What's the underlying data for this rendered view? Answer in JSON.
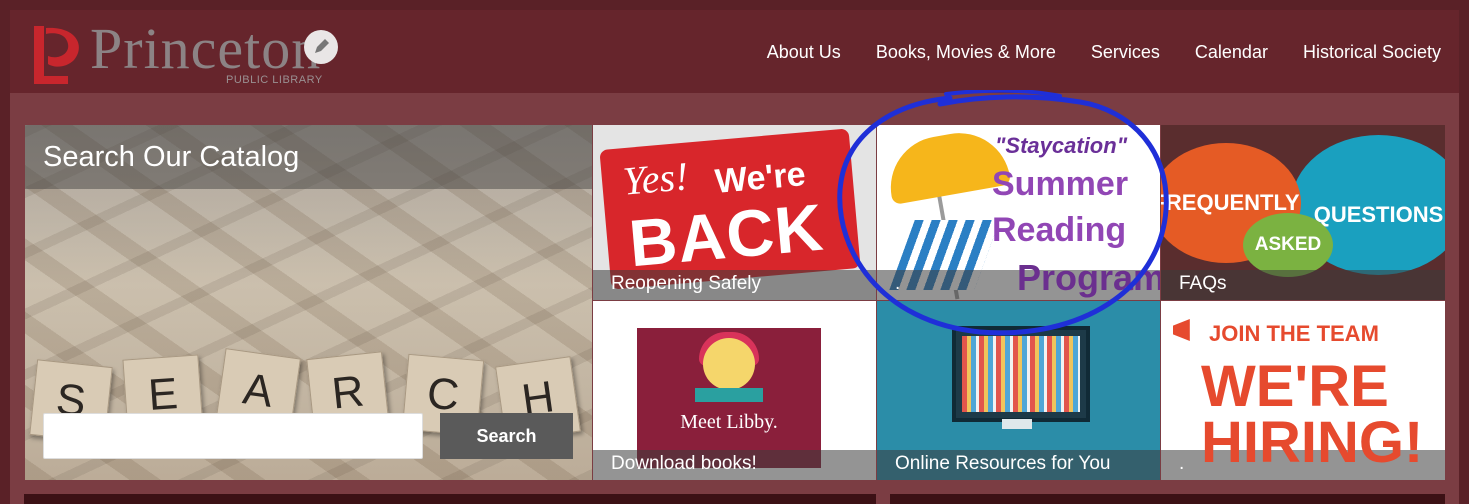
{
  "logo": {
    "name": "Princeton",
    "subtitle": "PUBLIC LIBRARY"
  },
  "nav": {
    "items": [
      "About Us",
      "Books, Movies & More",
      "Services",
      "Calendar",
      "Historical Society"
    ]
  },
  "search": {
    "title": "Search Our Catalog",
    "input_value": "",
    "button_label": "Search",
    "letters": [
      "S",
      "E",
      "A",
      "R",
      "C",
      "H"
    ]
  },
  "tiles": {
    "reopen": {
      "caption": "Reopening Safely",
      "yes": "Yes!",
      "were": "We're",
      "back": "BACK"
    },
    "staycation": {
      "caption": ".",
      "line1": "\"Staycation\"",
      "line2": "Summer",
      "line3": "Reading",
      "line4": "Program"
    },
    "faq": {
      "caption": "FAQs",
      "word1": "FREQUENTLY",
      "word2": "ASKED",
      "word3": "QUESTIONS"
    },
    "libby": {
      "caption": "Download books!",
      "card_text": "Meet Libby."
    },
    "online": {
      "caption": "Online Resources for You"
    },
    "hiring": {
      "caption": ".",
      "line1": "JOIN THE TEAM",
      "line2": "WE'RE",
      "line3": "HIRING!"
    }
  },
  "colors": {
    "header_bg": "#66252c",
    "page_bg": "#7b3d43",
    "annotation": "#1f2fd8"
  }
}
